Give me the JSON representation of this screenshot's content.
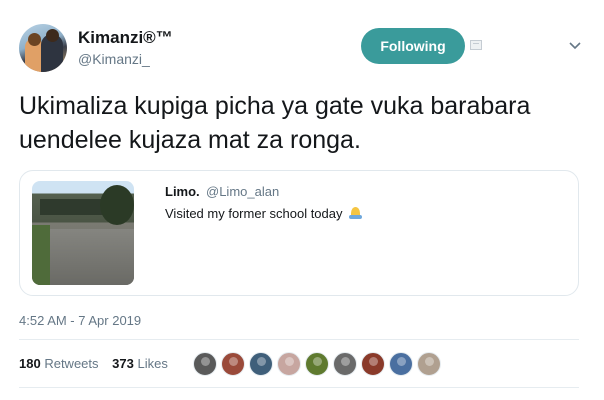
{
  "author": {
    "name": "Kimanzi®™",
    "handle": "@Kimanzi_"
  },
  "actions": {
    "follow_label": "Following",
    "dm_icon": "direct-message-icon",
    "caret_icon": "chevron-down-icon"
  },
  "tweet": {
    "text": "Ukimaliza kupiga picha ya gate vuka barabara uendelee kujaza mat za ronga."
  },
  "quoted": {
    "name": "Limo.",
    "handle": "@Limo_alan",
    "text": "Visited my former school today",
    "emoji_icon": "folded-hands-icon"
  },
  "meta": {
    "timestamp": "4:52 AM - 7 Apr 2019"
  },
  "stats": {
    "retweets_count": "180",
    "retweets_label": "Retweets",
    "likes_count": "373",
    "likes_label": "Likes"
  },
  "colors": {
    "follow_button": "#3a9b9b",
    "secondary_text": "#657786",
    "primary_text": "#14171a"
  },
  "likers": [
    {
      "color": "#5a5a5a"
    },
    {
      "color": "#9a4a3a"
    },
    {
      "color": "#3f5f7a"
    },
    {
      "color": "#c7a6a0"
    },
    {
      "color": "#5f7a2f"
    },
    {
      "color": "#6a6a6a"
    },
    {
      "color": "#8a3a2a"
    },
    {
      "color": "#4a6fa0"
    },
    {
      "color": "#b0a090"
    }
  ]
}
